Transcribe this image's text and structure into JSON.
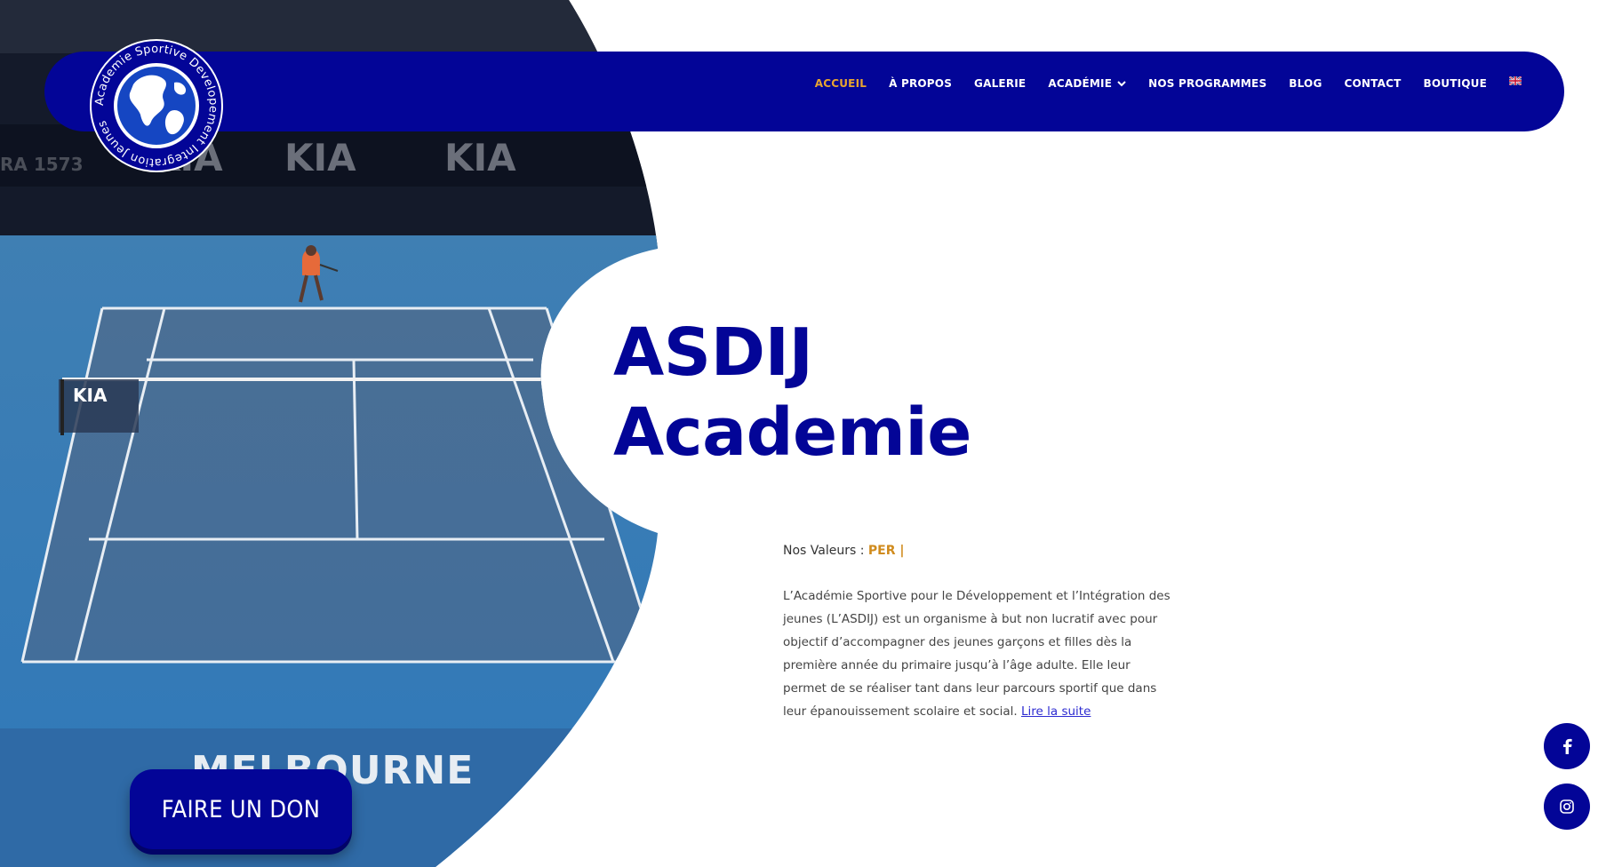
{
  "brand": {
    "logo_text": "Academie Sportive Developement Integration Jeunes",
    "primary_color": "#030597",
    "accent_color": "#e8a530"
  },
  "nav": {
    "items": [
      {
        "label": "ACCUEIL",
        "active": true
      },
      {
        "label": "À PROPOS",
        "active": false
      },
      {
        "label": "GALERIE",
        "active": false
      },
      {
        "label": "ACADÉMIE",
        "active": false,
        "has_dropdown": true
      },
      {
        "label": "NOS PROGRAMMES",
        "active": false
      },
      {
        "label": "BLOG",
        "active": false
      },
      {
        "label": "CONTACT",
        "active": false
      },
      {
        "label": "BOUTIQUE",
        "active": false
      }
    ],
    "language_flag": "uk-flag-icon"
  },
  "hero": {
    "title_line1": "ASDIJ",
    "title_line2": "Academie",
    "values_label": "Nos Valeurs :",
    "values_value": "PER |",
    "description": "L’Académie Sportive pour le Développement et l’Intégration des jeunes (L’ASDIJ) est un organisme à but non lucratif avec pour objectif d’accompagner des jeunes garçons et filles dès la première année du primaire jusqu’à l’âge adulte. Elle leur permet de se réaliser tant dans leur parcours sportif que dans leur épanouissement scolaire et social.",
    "read_more": "Lire la suite",
    "court_banner": "MELBOURNE"
  },
  "donate": {
    "label": "FAIRE UN DON"
  },
  "social": [
    {
      "name": "facebook-icon"
    },
    {
      "name": "instagram-icon"
    }
  ]
}
